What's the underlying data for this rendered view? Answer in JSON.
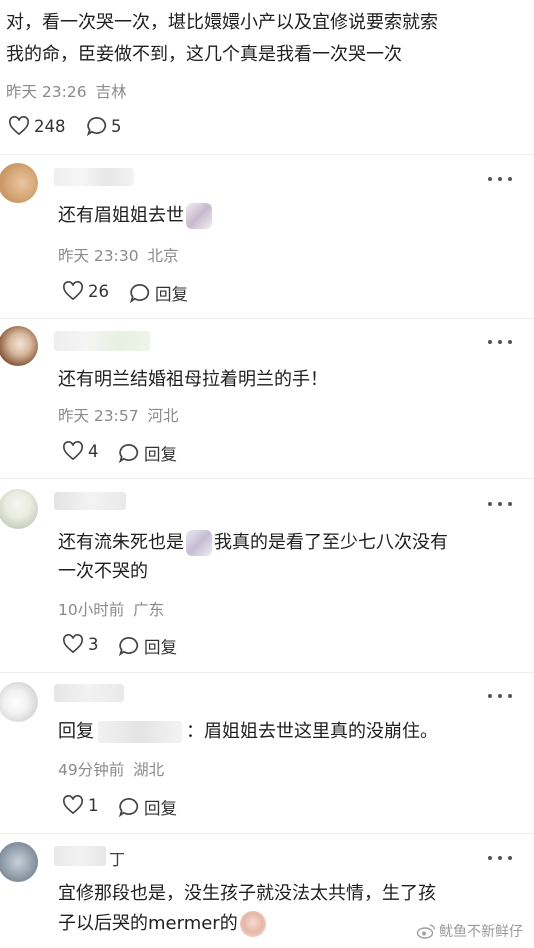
{
  "post": {
    "text_line1": "对，看一次哭一次，堪比嬛嬛小产以及宜修说要索就索",
    "text_line2": "我的命，臣妾做不到，这几个真是我看一次哭一次",
    "time": "昨天 23:26",
    "location": "吉林",
    "likes": "248",
    "comments": "5"
  },
  "reply_label": "回复",
  "comments": [
    {
      "user_partial": "",
      "text": "还有眉姐姐去世",
      "time": "昨天 23:30",
      "location": "北京",
      "likes": "26"
    },
    {
      "user_partial": "",
      "text": "还有明兰结婚祖母拉着明兰的手！",
      "time": "昨天 23:57",
      "location": "河北",
      "likes": "4"
    },
    {
      "user_partial": "",
      "text_a": "还有流朱死也是",
      "text_b": "我真的是看了至少七八次没有",
      "text_c": "一次不哭的",
      "time": "10小时前",
      "location": "广东",
      "likes": "3"
    },
    {
      "user_partial": "",
      "text_prefix": "回复",
      "text_suffix": "：眉姐姐去世这里真的没崩住。",
      "time": "49分钟前",
      "location": "湖北",
      "likes": "1"
    },
    {
      "user_partial": "丁",
      "text_line1": "宜修那段也是，没生孩子就没法太共情，生了孩",
      "text_line2": "子以后哭的mermer的"
    }
  ],
  "watermark": "鱿鱼不新鲜仔",
  "colors": {
    "text": "#1f1f1f",
    "meta": "#8a8a8a",
    "divider": "#ececec"
  }
}
